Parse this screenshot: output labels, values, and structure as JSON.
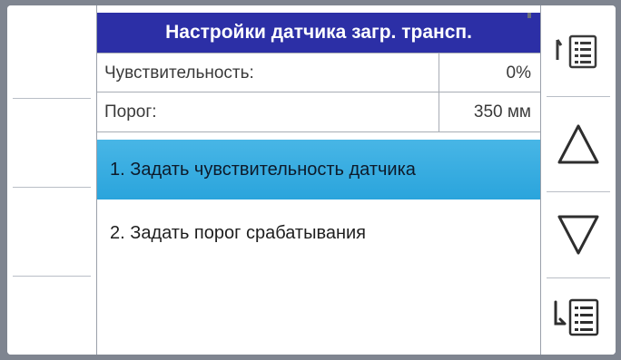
{
  "title": "Настройки датчика загр. трансп.",
  "params": [
    {
      "label": "Чувствительность:",
      "value": "0%"
    },
    {
      "label": "Порог:",
      "value": "350 мм"
    }
  ],
  "menu": [
    {
      "label": "1.  Задать чувствительность датчика",
      "selected": true
    },
    {
      "label": "2.  Задать порог срабатывания",
      "selected": false
    }
  ],
  "colors": {
    "title_bg": "#2c2fa6",
    "selected_bg": "#34aae0"
  },
  "icons": {
    "menu_up": "list-up-icon",
    "scroll_up": "triangle-up-icon",
    "scroll_down": "triangle-down-icon",
    "menu_down": "list-down-icon"
  }
}
